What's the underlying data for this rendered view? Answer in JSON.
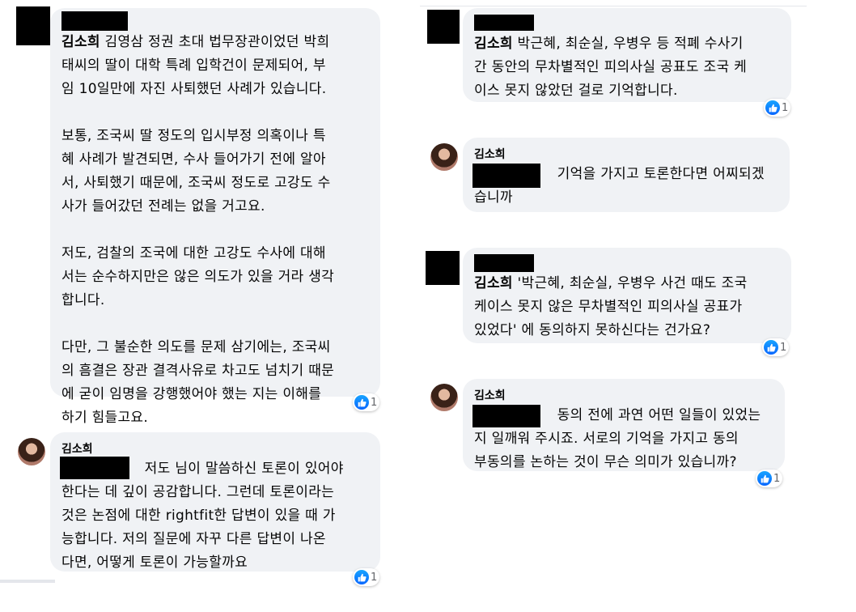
{
  "messages": [
    {
      "author": "김소희",
      "text": " 김영삼 정권 초대 법무장관이었던 박희\n태씨의 딸이 대학 특례 입학건이 문제되어, 부\n임 10일만에 자진 사퇴했던 사례가 있습니다.\n\n보통, 조국씨 딸 정도의 입시부정 의혹이나 특\n혜 사례가 발견되면, 수사 들어가기 전에 알아\n서, 사퇴했기 때문에, 조국씨 정도로 고강도 수\n사가 들어갔던 전례는 없을 거고요.\n\n저도, 검찰의 조국에 대한 고강도 수사에 대해\n서는 순수하지만은 않은 의도가 있을 거라 생각\n합니다.\n\n다만, 그 불순한 의도를 문제 삼기에는, 조국씨\n의 흠결은 장관 결격사유로 차고도 넘치기 때문\n에 굳이 임명을 강행했어야 했는 지는 이해를\n하기 힘들고요.",
      "reaction_count": "1"
    },
    {
      "author": "김소희",
      "text": "                  저도 님이 말씀하신 토론이 있어야\n한다는 데 깊이 공감합니다. 그런데 토론이라는\n것은 논점에 대한 rightfit한 답변이 있을 때 가\n능합니다. 저의 질문에 자꾸 다른 답변이 나온\n다면, 어떻게 토론이 가능할까요",
      "reaction_count": "1"
    },
    {
      "author": "김소희",
      "text": " 박근혜, 최순실, 우병우 등 적폐 수사기\n간 동안의 무차별적인 피의사실 공표도 조국 케\n이스 못지 않았던 걸로 기억합니다.",
      "reaction_count": "1"
    },
    {
      "author": "김소희",
      "text": "                  기억을 가지고 토론한다면 어찌되겠\n습니까"
    },
    {
      "author": "김소희",
      "text": " '박근혜, 최순실, 우병우 사건 때도 조국\n케이스 못지 않은 무차별적인 피의사실 공표가\n있었다' 에 동의하지 못하신다는 건가요?",
      "reaction_count": "1"
    },
    {
      "author": "김소희",
      "text": "                  동의 전에 과연 어떤 일들이 있었는\n지 일깨워 주시죠. 서로의 기억을 가지고 동의\n부동의를 논하는 것이 무슨 의미가 있습니까?",
      "reaction_count": "1"
    }
  ],
  "colors": {
    "bubble": "#f0f2f5",
    "like_blue": "#0866ff",
    "meta": "#65676b"
  },
  "icons": {
    "reaction": "like-thumb-icon"
  }
}
